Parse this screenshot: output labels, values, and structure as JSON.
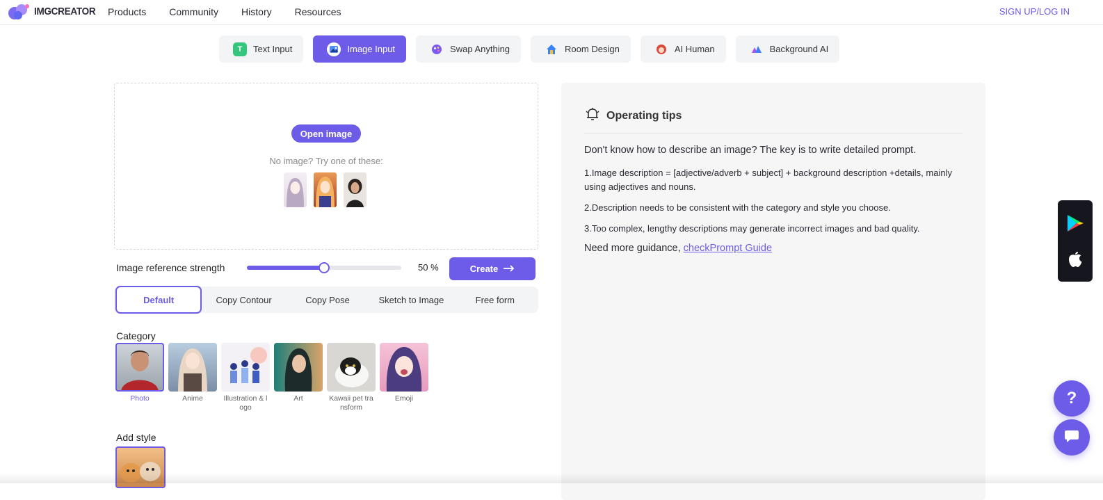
{
  "brand": {
    "name": "IMGCREATOR"
  },
  "nav": {
    "items": [
      "Products",
      "Community",
      "History",
      "Resources"
    ],
    "signin": "SIGN UP/LOG IN"
  },
  "tabs": [
    {
      "label": "Text Input",
      "icon": "text-input-icon",
      "active": false
    },
    {
      "label": "Image Input",
      "icon": "image-input-icon",
      "active": true
    },
    {
      "label": "Swap Anything",
      "icon": "swap-anything-icon",
      "active": false
    },
    {
      "label": "Room Design",
      "icon": "room-design-icon",
      "active": false
    },
    {
      "label": "AI Human",
      "icon": "ai-human-icon",
      "active": false
    },
    {
      "label": "Background AI",
      "icon": "background-ai-icon",
      "active": false
    }
  ],
  "upload": {
    "button": "Open image",
    "try_text": "No image? Try one of these:"
  },
  "strength": {
    "label": "Image reference strength",
    "value": 50,
    "display": "50 %"
  },
  "create": {
    "label": "Create"
  },
  "modes": [
    {
      "label": "Default",
      "active": true
    },
    {
      "label": "Copy Contour",
      "active": false
    },
    {
      "label": "Copy Pose",
      "active": false
    },
    {
      "label": "Sketch to Image",
      "active": false
    },
    {
      "label": "Free form",
      "active": false
    }
  ],
  "category": {
    "title": "Category",
    "items": [
      {
        "label": "Photo",
        "active": true
      },
      {
        "label": "Anime",
        "active": false
      },
      {
        "label": "Illustration & l ogo",
        "active": false
      },
      {
        "label": "Art",
        "active": false
      },
      {
        "label": "Kawaii pet tra nsform",
        "active": false
      },
      {
        "label": "Emoji",
        "active": false
      }
    ]
  },
  "add_style": {
    "title": "Add style"
  },
  "tips": {
    "title": "Operating tips",
    "lead": "Don't know how to describe an image? The key is to write detailed prompt.",
    "items": [
      "1.Image description = [adjective/adverb + subject] + background description +details, mainly using adjectives and nouns.",
      "2.Description needs to be consistent with the category and style you choose.",
      "3.Too complex, lengthy descriptions may generate incorrect images and bad quality."
    ],
    "more_prefix": "Need more guidance, ",
    "more_link": "checkPrompt Guide"
  },
  "colors": {
    "accent": "#6c5ce7",
    "panel": "#f6f6f7",
    "store_bg": "#16161f"
  }
}
